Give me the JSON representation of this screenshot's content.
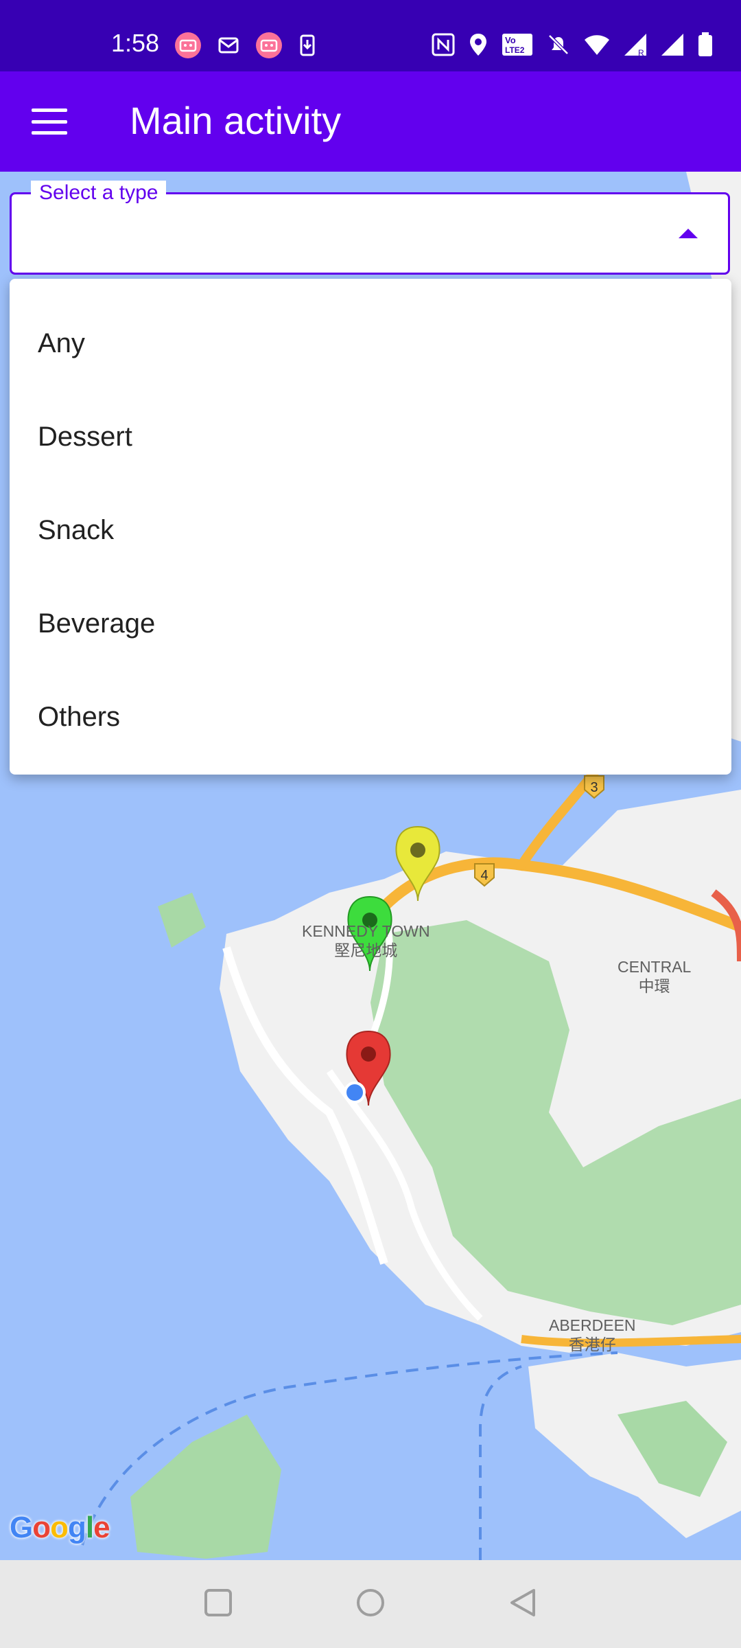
{
  "status_bar": {
    "time": "1:58",
    "left_icons": [
      "bilibili-icon",
      "mail-icon",
      "bilibili-icon",
      "download-icon"
    ],
    "right_icons": [
      "nfc-icon",
      "location-icon",
      "volte-icon",
      "mute-icon",
      "wifi-icon",
      "signal-roaming-icon",
      "signal-icon",
      "battery-icon"
    ]
  },
  "app_bar": {
    "title": "Main activity"
  },
  "type_select": {
    "label": "Select a type",
    "value": "",
    "expanded": true,
    "options": [
      "Any",
      "Dessert",
      "Snack",
      "Beverage",
      "Others"
    ]
  },
  "map": {
    "labels": {
      "kennedy_town_en": "KENNEDY TOWN",
      "kennedy_town_zh": "堅尼地城",
      "central_en": "CENTRAL",
      "central_zh": "中環",
      "aberdeen_en": "ABERDEEN",
      "aberdeen_zh": "香港仔",
      "route_3": "3",
      "route_4": "4"
    },
    "markers": [
      {
        "name": "yellow-marker",
        "color": "#e8e83a"
      },
      {
        "name": "green-marker",
        "color": "#3ddc3d"
      },
      {
        "name": "red-marker",
        "color": "#e53935"
      }
    ],
    "attribution": "Google"
  },
  "colors": {
    "primary": "#6200ee",
    "primary_dark": "#3700b3",
    "water": "#9ec1fb",
    "land": "#f1f1f1",
    "park": "#a8d9a6",
    "road": "#f7b538"
  }
}
